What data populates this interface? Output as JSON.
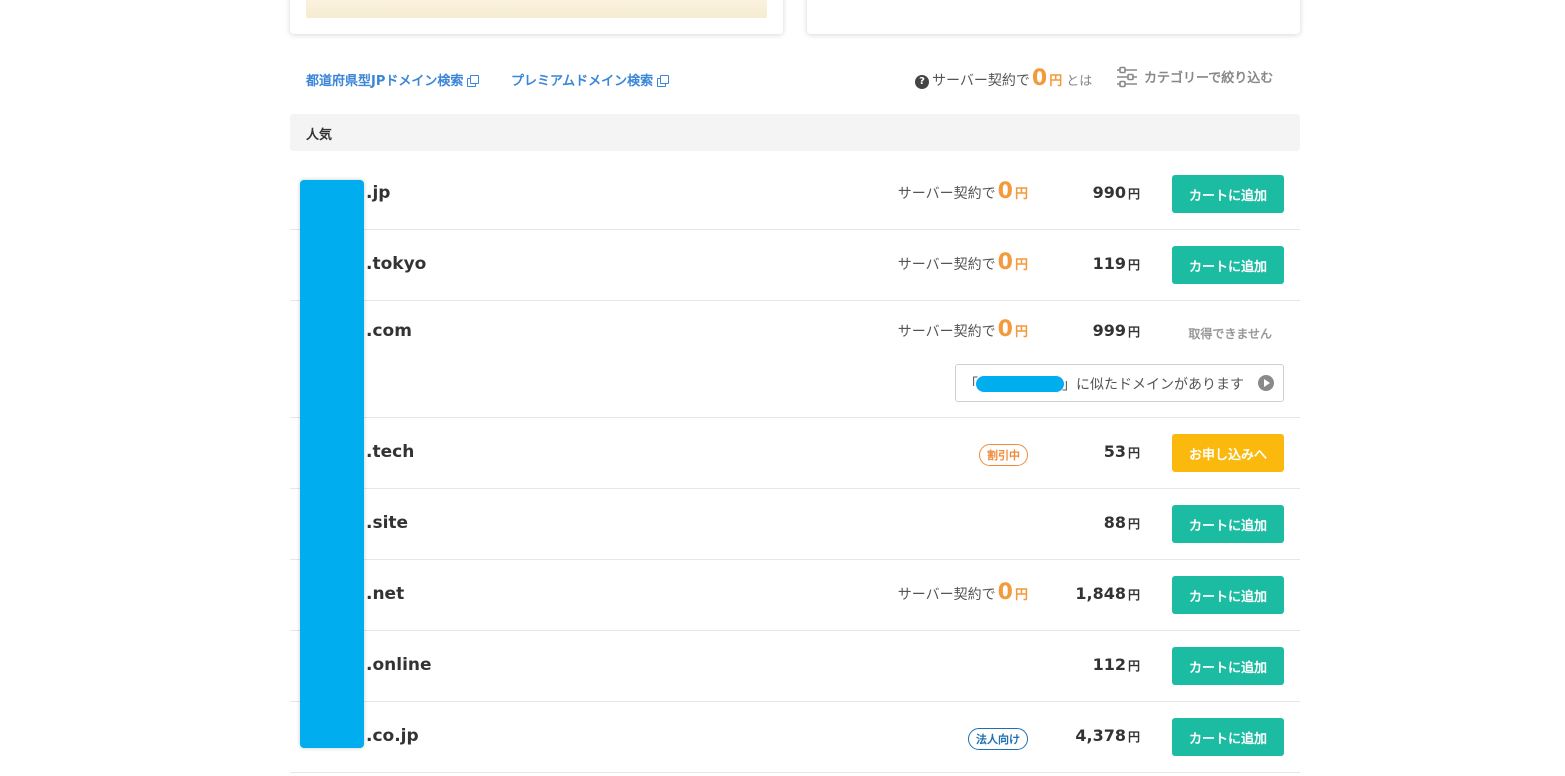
{
  "links": [
    {
      "label": "都道府県型JPドメイン検索"
    },
    {
      "label": "プレミアムドメイン検索"
    }
  ],
  "promo": {
    "prefix": "サーバー契約で",
    "zero": "0",
    "yen": "円",
    "suffix": "とは"
  },
  "filter": {
    "label": "カテゴリーで絞り込む"
  },
  "section": {
    "title": "人気"
  },
  "campaign": {
    "prefix": "サーバー契約で",
    "zero": "0",
    "yen": "円"
  },
  "currency": "円",
  "buttons": {
    "cart": "カートに追加",
    "apply": "お申し込みへ"
  },
  "unavailable": "取得できません",
  "similar": {
    "open": "「",
    "close": "」に似たドメインがあります"
  },
  "badges": {
    "discount": "割引中",
    "corp": "法人向け"
  },
  "rows": [
    {
      "tld": ".jp",
      "price": "990"
    },
    {
      "tld": ".tokyo",
      "price": "119"
    },
    {
      "tld": ".com",
      "price": "999"
    },
    {
      "tld": ".tech",
      "price": "53"
    },
    {
      "tld": ".site",
      "price": "88"
    },
    {
      "tld": ".net",
      "price": "1,848"
    },
    {
      "tld": ".online",
      "price": "112"
    },
    {
      "tld": ".co.jp",
      "price": "4,378"
    }
  ],
  "colors": {
    "accent_teal": "#1cbca2",
    "accent_yellow": "#fbb90d",
    "promo_orange": "#f39a3c",
    "link_blue": "#3b86d8",
    "redaction": "#00adee"
  }
}
